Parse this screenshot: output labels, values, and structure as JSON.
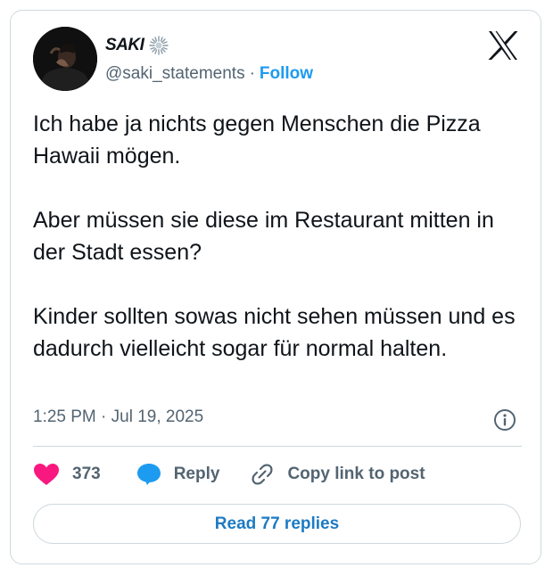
{
  "author": {
    "name": "SAKI",
    "handle": "@saki_statements",
    "separator": "·",
    "follow_label": "Follow",
    "badge_icon": "burst-badge-icon",
    "avatar_icon": "profile-photo"
  },
  "brand": {
    "logo_icon": "x-logo-icon"
  },
  "tweet": {
    "paragraphs": [
      "Ich habe ja nichts gegen Menschen die Pizza Hawaii mögen.",
      "Aber müssen sie diese im Restaurant mitten in der Stadt essen?",
      "Kinder sollten sowas nicht sehen müssen und es dadurch vielleicht sogar für normal halten."
    ],
    "timestamp": "1:25 PM · Jul 19, 2025",
    "info_icon": "info-icon"
  },
  "actions": {
    "like_count": "373",
    "like_icon": "heart-icon",
    "reply_label": "Reply",
    "reply_icon": "speech-bubble-icon",
    "copy_label": "Copy link to post",
    "copy_icon": "link-icon"
  },
  "footer": {
    "read_replies_label": "Read 77 replies"
  },
  "colors": {
    "accent": "#1d9bf0",
    "like": "#f91880",
    "muted": "#536471",
    "border": "#cfd9de",
    "text": "#0f1419"
  }
}
